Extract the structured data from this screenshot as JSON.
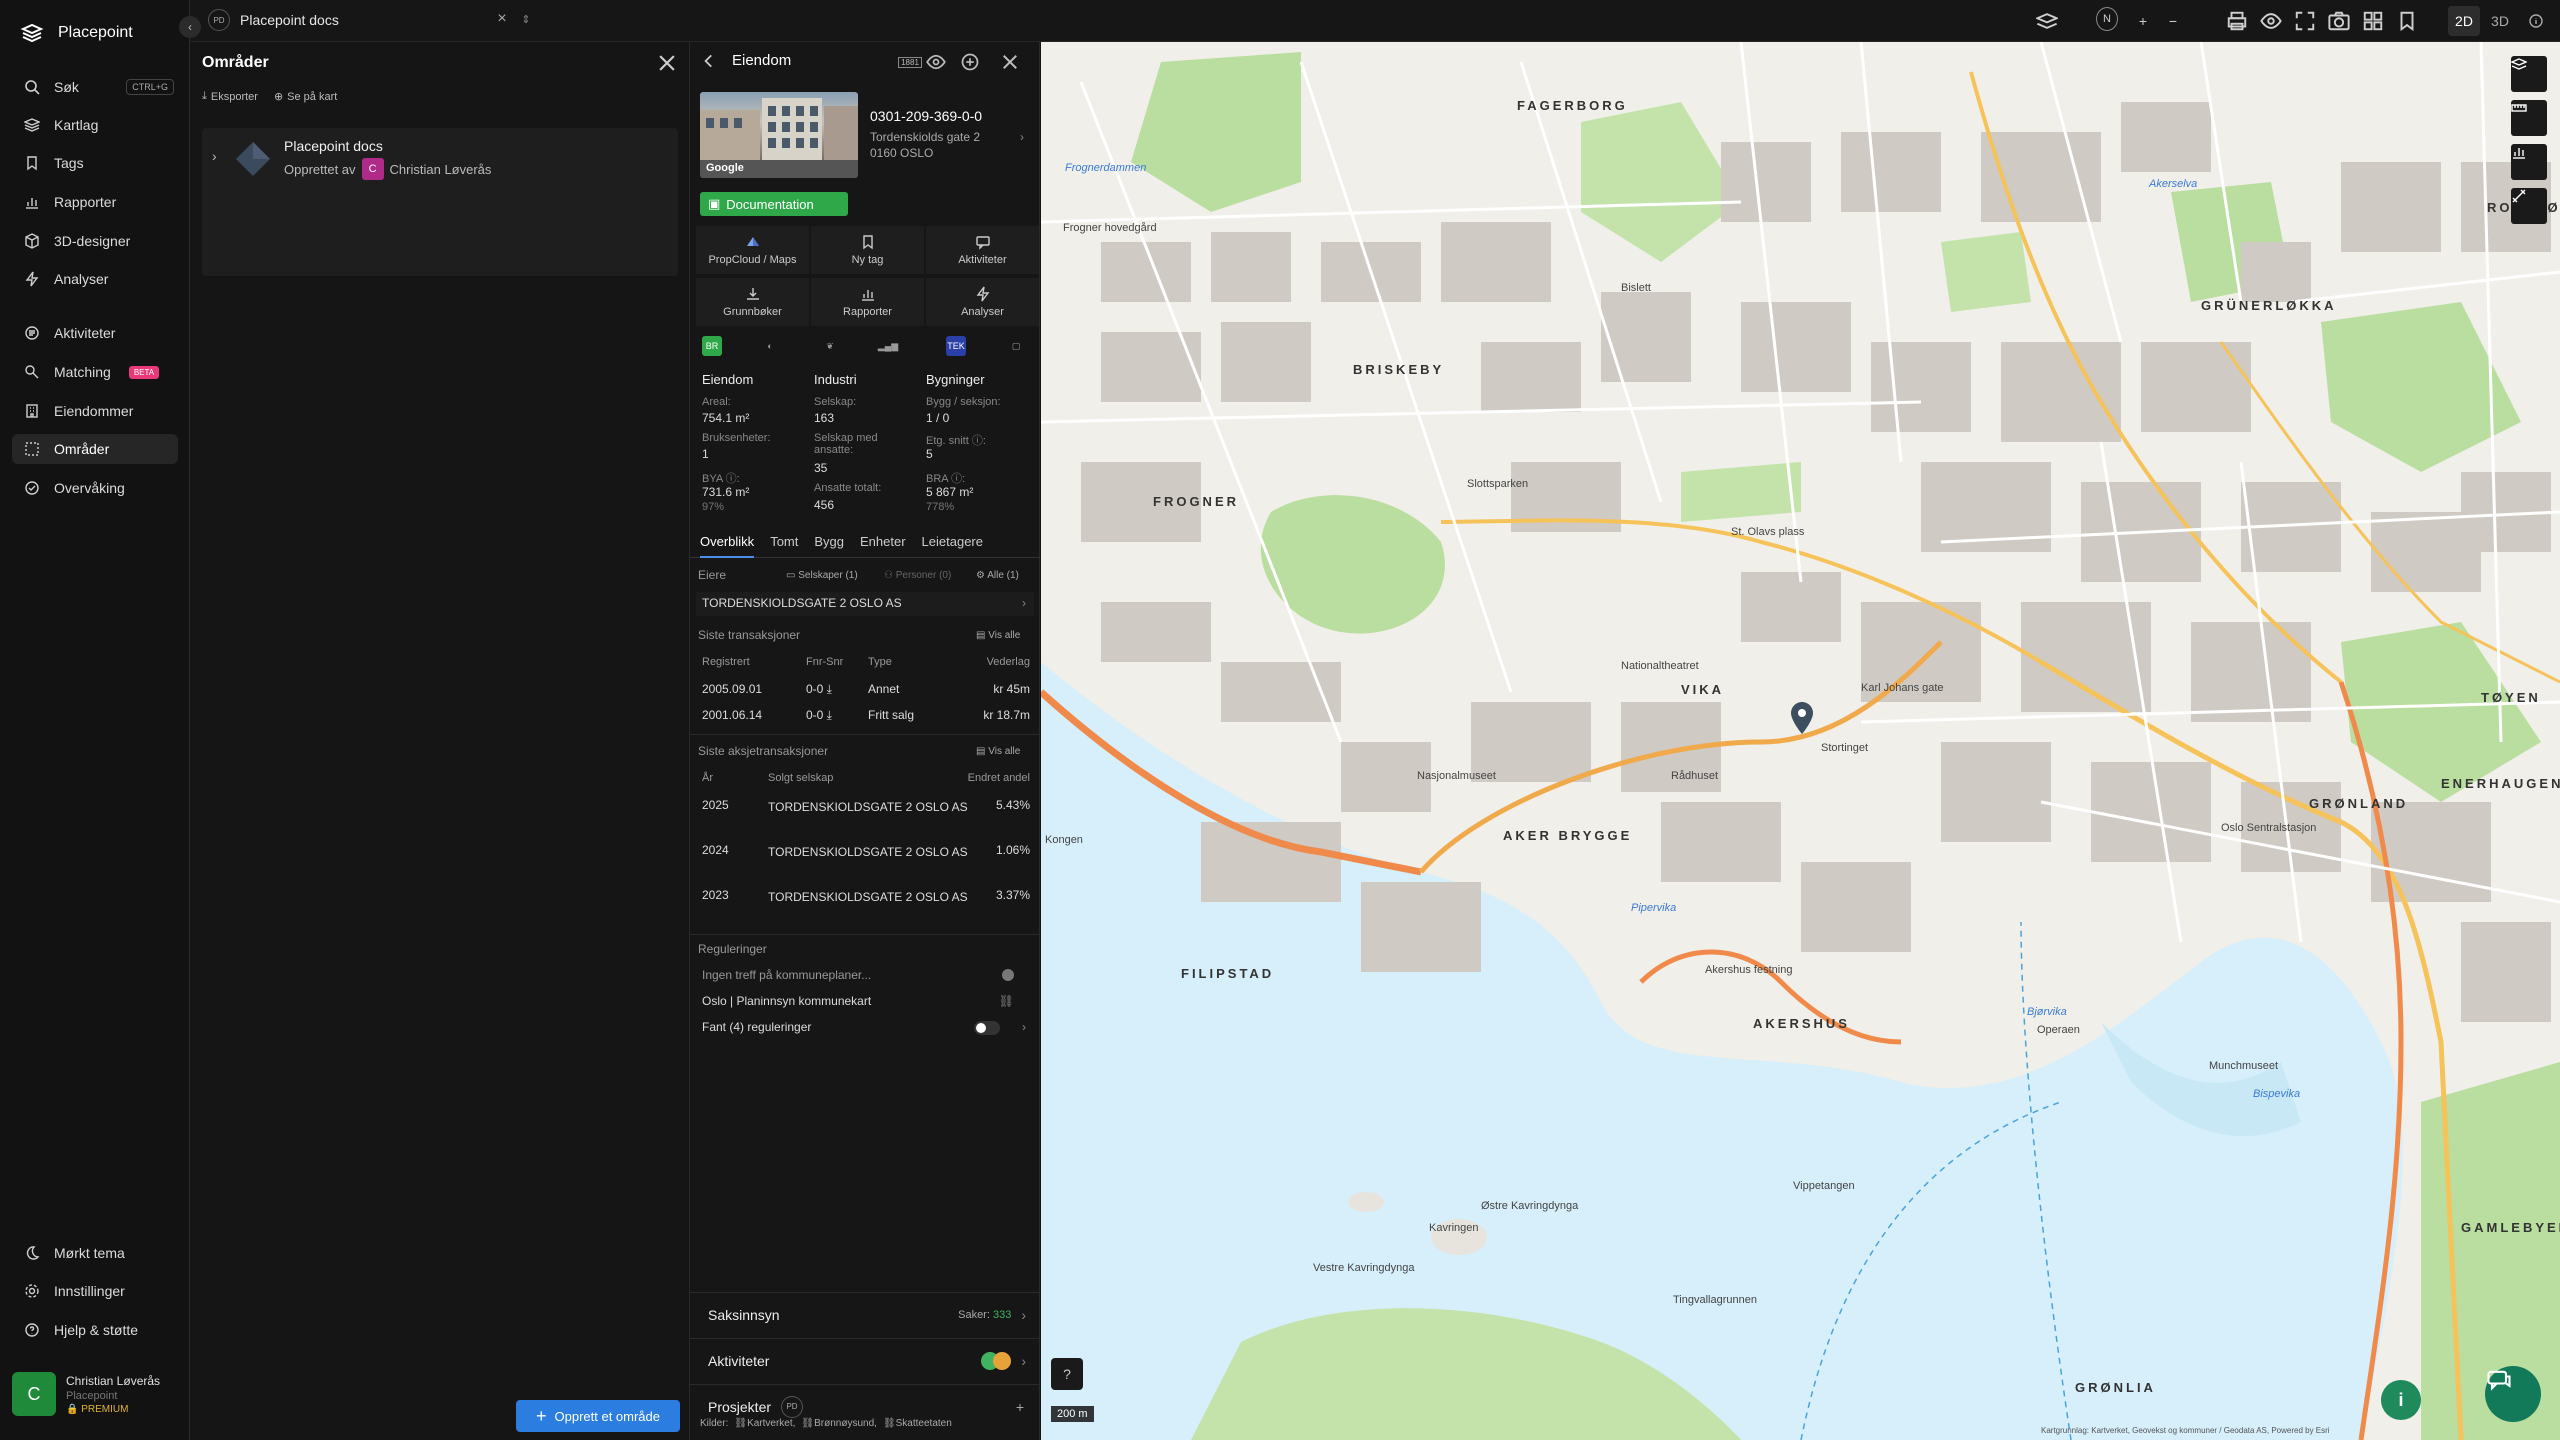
{
  "app": {
    "name": "Placepoint"
  },
  "sidebar": {
    "items": [
      {
        "label": "Søk",
        "shortcut": "CTRL+G"
      },
      {
        "label": "Kartlag"
      },
      {
        "label": "Tags"
      },
      {
        "label": "Rapporter"
      },
      {
        "label": "3D-designer"
      },
      {
        "label": "Analyser"
      },
      {
        "label": "Aktiviteter"
      },
      {
        "label": "Matching",
        "badge": "BETA"
      },
      {
        "label": "Eiendommer"
      },
      {
        "label": "Områder"
      },
      {
        "label": "Overvåking"
      }
    ],
    "bottom": [
      {
        "label": "Mørkt tema"
      },
      {
        "label": "Innstillinger"
      },
      {
        "label": "Hjelp & støtte"
      }
    ],
    "user": {
      "initial": "C",
      "name": "Christian Løverås",
      "org": "Placepoint",
      "plan": "PREMIUM"
    },
    "active": "Områder"
  },
  "topbar": {
    "workspace_badge": "PD",
    "workspace_name": "Placepoint docs",
    "north": "N",
    "view_2d": "2D",
    "view_3d": "3D",
    "active_view": "2D"
  },
  "areas": {
    "title": "Områder",
    "export_label": "Eksporter",
    "map_label": "Se på kart",
    "card": {
      "name": "Placepoint docs",
      "created_by_label": "Opprettet av",
      "avatar": "C",
      "author": "Christian Løverås"
    },
    "create_button": "Opprett et område"
  },
  "property": {
    "title": "Eiendom",
    "matrikkel": "0301-209-369-0-0",
    "address_line1": "Tordenskiolds gate 2",
    "address_line2": "0160 OSLO",
    "photo_credit": "Google",
    "tag": "Documentation",
    "quick_actions": [
      "PropCloud / Maps",
      "Ny tag",
      "Aktiviteter",
      "Grunnbøker",
      "Rapporter",
      "Analyser"
    ],
    "source_badges": [
      "BR",
      "TEK"
    ],
    "stats": {
      "eiendom": {
        "heading": "Eiendom",
        "areal_label": "Areal:",
        "areal_value": "754.1 m²",
        "bruksenheter_label": "Bruksenheter:",
        "bruksenheter_value": "1",
        "bya_label": "BYA ⓘ:",
        "bya_value": "731.6 m²",
        "bya_pct": "97%"
      },
      "industri": {
        "heading": "Industri",
        "selskap_label": "Selskap:",
        "selskap_value": "163",
        "med_ansatte_label": "Selskap med ansatte:",
        "med_ansatte_value": "35",
        "ansatte_label": "Ansatte totalt:",
        "ansatte_value": "456"
      },
      "bygninger": {
        "heading": "Bygninger",
        "bygg_label": "Bygg / seksjon:",
        "bygg_value": "1 / 0",
        "etg_label": "Etg. snitt ⓘ:",
        "etg_value": "5",
        "bra_label": "BRA ⓘ:",
        "bra_value": "5 867 m²",
        "bra_pct": "778%"
      }
    },
    "tabs": [
      "Overblikk",
      "Tomt",
      "Bygg",
      "Enheter",
      "Leietagere"
    ],
    "active_tab": "Overblikk",
    "owners": {
      "label": "Eiere",
      "filter_companies": "Selskaper (1)",
      "filter_persons": "Personer (0)",
      "filter_all": "Alle (1)",
      "owner": "TORDENSKIOLDSGATE 2 OSLO AS"
    },
    "transactions": {
      "label": "Siste transaksjoner",
      "show_all": "Vis alle",
      "headers": [
        "Registrert",
        "Fnr-Snr",
        "Type",
        "Vederlag"
      ],
      "rows": [
        {
          "date": "2005.09.01",
          "fnr": "0-0",
          "type": "Annet",
          "amount": "kr 45m"
        },
        {
          "date": "2001.06.14",
          "fnr": "0-0",
          "type": "Fritt salg",
          "amount": "kr 18.7m"
        }
      ]
    },
    "share_transactions": {
      "label": "Siste aksjetransaksjoner",
      "show_all": "Vis alle",
      "headers": [
        "År",
        "Solgt selskap",
        "Endret andel"
      ],
      "rows": [
        {
          "year": "2025",
          "company": "TORDENSKIOLDSGATE 2 OSLO AS",
          "change": "5.43%"
        },
        {
          "year": "2024",
          "company": "TORDENSKIOLDSGATE 2 OSLO AS",
          "change": "1.06%"
        },
        {
          "year": "2023",
          "company": "TORDENSKIOLDSGATE 2 OSLO AS",
          "change": "3.37%"
        }
      ]
    },
    "regulations": {
      "label": "Reguleringer",
      "no_hits": "Ingen treff på kommuneplaner...",
      "planinnsyn": "Oslo | Planinnsyn kommunekart",
      "found": "Fant (4) reguleringer"
    },
    "footer": {
      "saksinnsyn": "Saksinnsyn",
      "saker_label": "Saker:",
      "saker_value": "333",
      "aktiviteter": "Aktiviteter",
      "prosjekter": "Prosjekter",
      "prosjekter_badge": "PD",
      "sources_label": "Kilder:",
      "sources": [
        "Kartverket",
        "Brønnøysund",
        "Skatteetaten"
      ]
    }
  },
  "map": {
    "scale": "200 m",
    "attribution": "Kartgrunnlag: Kartverket, Geovekst og kommuner / Geodata AS, Powered by Esri",
    "districts": [
      "FAGERBORG",
      "BRISKEBY",
      "FROGNER",
      "GRÜNERLØKKA",
      "AKER BRYGGE",
      "FILIPSTAD",
      "AKERSHUS",
      "GRØNLAND",
      "ENERHAUGEN",
      "TØYEN",
      "GAMLEBYEN",
      "GRØNLIA",
      "VIKA",
      "RODELØKKA"
    ],
    "places": [
      "Frognerdammen",
      "Frogner hovedgård",
      "Akerselva",
      "Bislett",
      "Slottsparken",
      "St. Olavs plass",
      "Nationaltheatret",
      "Karl Johans gate",
      "Stortinget",
      "Oslo Sentralstasjon",
      "Akershus festning",
      "Operaen",
      "Bjørvika",
      "Kavringen",
      "Vestre Kavringdynga",
      "Østre Kavringdynga",
      "Tingvallagrunnen",
      "Pipervika",
      "Kongen",
      "Bispevika",
      "Rådhuset",
      "Nasjonalmuseet",
      "Vippetangen",
      "Munchmuseet"
    ]
  }
}
